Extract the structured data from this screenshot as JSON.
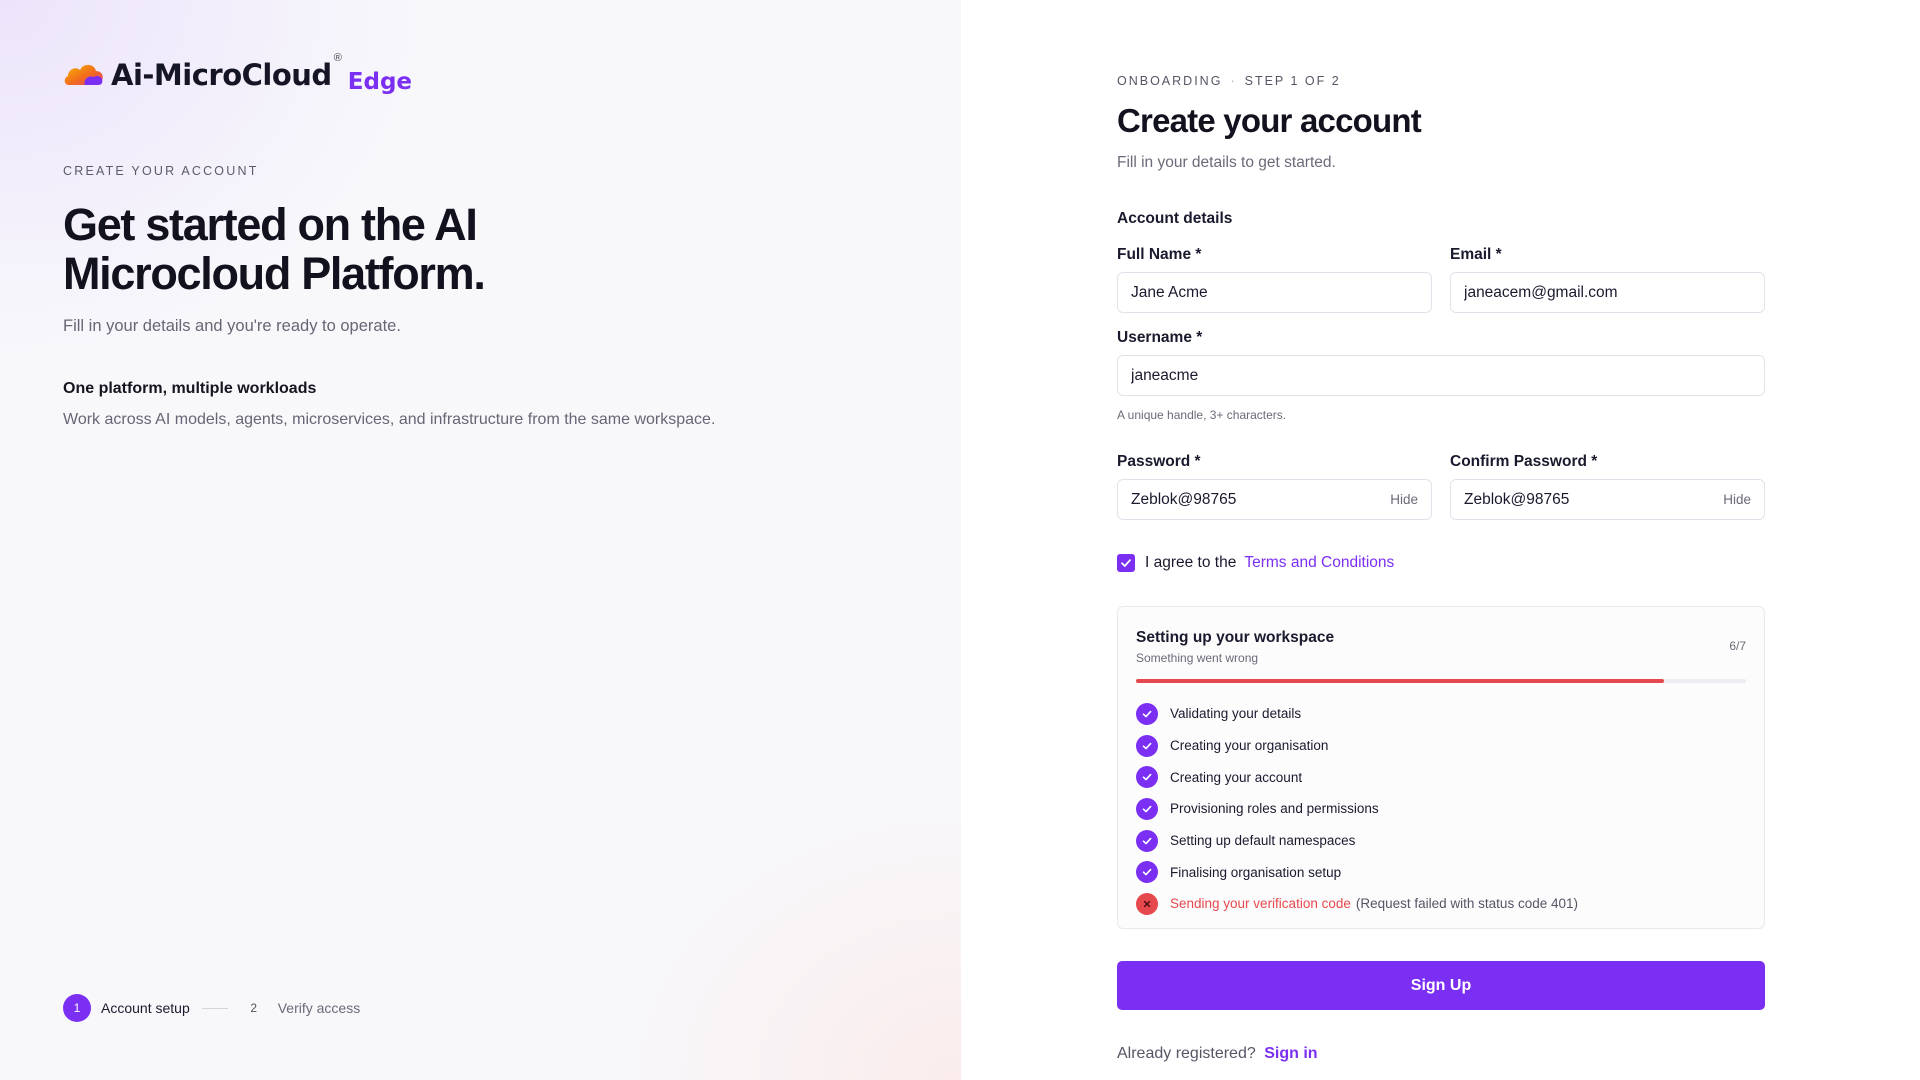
{
  "brand": {
    "name": "Ai-MicroCloud",
    "registered": "®",
    "edition": "Edge",
    "accent": "#7b2ff2"
  },
  "left": {
    "eyebrow": "CREATE YOUR ACCOUNT",
    "headline_line1": "Get started on the AI",
    "headline_line2": "Microcloud Platform.",
    "subheading": "Fill in your details and you're ready to operate.",
    "feature_title": "One platform, multiple workloads",
    "feature_desc": "Work across AI models, agents, microservices, and infrastructure from the same workspace.",
    "steps": [
      {
        "num": "1",
        "label": "Account setup",
        "active": true
      },
      {
        "num": "2",
        "label": "Verify access",
        "active": false
      }
    ]
  },
  "form": {
    "eyebrow_section": "ONBOARDING",
    "eyebrow_sep": "·",
    "eyebrow_step": "STEP 1 OF 2",
    "title": "Create your account",
    "subtitle": "Fill in your details to get started.",
    "section_label": "Account details",
    "full_name": {
      "label": "Full Name *",
      "value": "Jane Acme"
    },
    "email": {
      "label": "Email *",
      "value": "janeacem@gmail.com"
    },
    "username": {
      "label": "Username *",
      "value": "janeacme",
      "hint": "A unique handle, 3+ characters."
    },
    "password": {
      "label": "Password *",
      "value": "Zeblok@98765",
      "toggle": "Hide"
    },
    "confirm_password": {
      "label": "Confirm Password *",
      "value": "Zeblok@98765",
      "toggle": "Hide"
    },
    "agree_text": "I agree to the",
    "terms_link": "Terms and Conditions",
    "agree_checked": true,
    "submit_label": "Sign Up",
    "signin_prompt": "Already registered?",
    "signin_link": "Sign in"
  },
  "progress": {
    "title": "Setting up your workspace",
    "status": "Something went wrong",
    "count": "6/7",
    "fraction": 0.865,
    "error_color": "#e5484d",
    "items": [
      {
        "label": "Validating your details",
        "state": "done",
        "icon": "check-icon"
      },
      {
        "label": "Creating your organisation",
        "state": "done",
        "icon": "check-icon"
      },
      {
        "label": "Creating your account",
        "state": "done",
        "icon": "check-icon"
      },
      {
        "label": "Provisioning roles and permissions",
        "state": "done",
        "icon": "check-icon"
      },
      {
        "label": "Setting up default namespaces",
        "state": "done",
        "icon": "check-icon"
      },
      {
        "label": "Finalising organisation setup",
        "state": "done",
        "icon": "check-icon"
      },
      {
        "label": "Sending your verification code",
        "state": "failed",
        "icon": "x-icon",
        "detail": "(Request failed with status code 401)"
      }
    ]
  }
}
